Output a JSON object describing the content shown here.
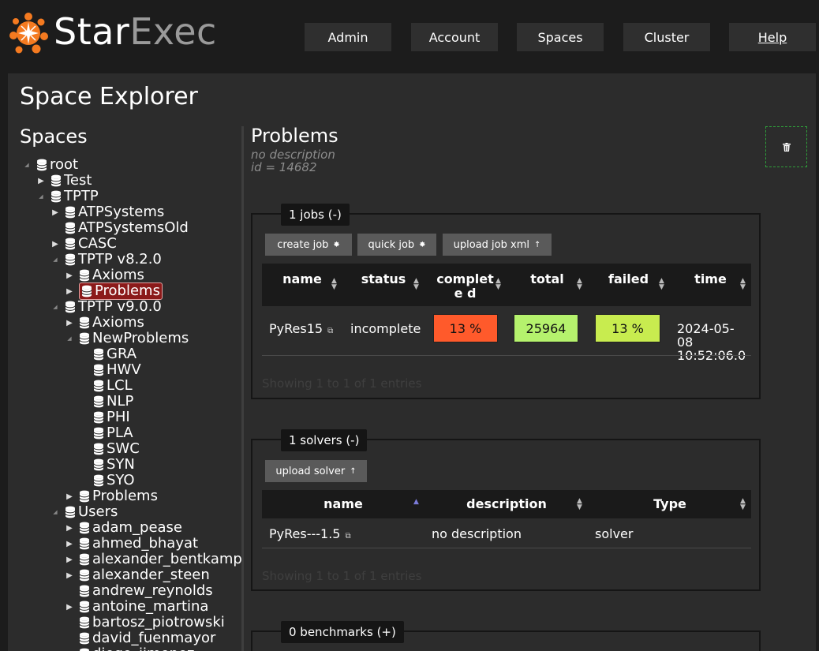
{
  "brand": {
    "star": "Star",
    "exec": "Exec"
  },
  "nav": [
    {
      "label": "Admin"
    },
    {
      "label": "Account"
    },
    {
      "label": "Spaces"
    },
    {
      "label": "Cluster"
    },
    {
      "label": "Help"
    }
  ],
  "page_title": "Space Explorer",
  "spaces_title": "Spaces",
  "tree": [
    {
      "label": "root",
      "depth": 0,
      "arrow": "open"
    },
    {
      "label": "Test",
      "depth": 1,
      "arrow": "closed"
    },
    {
      "label": "TPTP",
      "depth": 1,
      "arrow": "open"
    },
    {
      "label": "ATPSystems",
      "depth": 2,
      "arrow": "closed"
    },
    {
      "label": "ATPSystemsOld",
      "depth": 2,
      "arrow": "none"
    },
    {
      "label": "CASC",
      "depth": 2,
      "arrow": "closed"
    },
    {
      "label": "TPTP v8.2.0",
      "depth": 2,
      "arrow": "open"
    },
    {
      "label": "Axioms",
      "depth": 3,
      "arrow": "closed"
    },
    {
      "label": "Problems",
      "depth": 3,
      "arrow": "closed",
      "selected": true
    },
    {
      "label": "TPTP v9.0.0",
      "depth": 2,
      "arrow": "open"
    },
    {
      "label": "Axioms",
      "depth": 3,
      "arrow": "closed"
    },
    {
      "label": "NewProblems",
      "depth": 3,
      "arrow": "open"
    },
    {
      "label": "GRA",
      "depth": 4,
      "arrow": "none"
    },
    {
      "label": "HWV",
      "depth": 4,
      "arrow": "none"
    },
    {
      "label": "LCL",
      "depth": 4,
      "arrow": "none"
    },
    {
      "label": "NLP",
      "depth": 4,
      "arrow": "none"
    },
    {
      "label": "PHI",
      "depth": 4,
      "arrow": "none"
    },
    {
      "label": "PLA",
      "depth": 4,
      "arrow": "none"
    },
    {
      "label": "SWC",
      "depth": 4,
      "arrow": "none"
    },
    {
      "label": "SYN",
      "depth": 4,
      "arrow": "none"
    },
    {
      "label": "SYO",
      "depth": 4,
      "arrow": "none"
    },
    {
      "label": "Problems",
      "depth": 3,
      "arrow": "closed"
    },
    {
      "label": "Users",
      "depth": 2,
      "arrow": "open"
    },
    {
      "label": "adam_pease",
      "depth": 3,
      "arrow": "closed"
    },
    {
      "label": "ahmed_bhayat",
      "depth": 3,
      "arrow": "closed"
    },
    {
      "label": "alexander_bentkamp",
      "depth": 3,
      "arrow": "closed"
    },
    {
      "label": "alexander_steen",
      "depth": 3,
      "arrow": "closed"
    },
    {
      "label": "andrew_reynolds",
      "depth": 3,
      "arrow": "none"
    },
    {
      "label": "antoine_martina",
      "depth": 3,
      "arrow": "closed"
    },
    {
      "label": "bartosz_piotrowski",
      "depth": 3,
      "arrow": "none"
    },
    {
      "label": "david_fuenmayor",
      "depth": 3,
      "arrow": "none"
    },
    {
      "label": "diego_jimenez",
      "depth": 3,
      "arrow": "none"
    }
  ],
  "space": {
    "name": "Problems",
    "description": "no description",
    "id_text": "id = 14682"
  },
  "jobs": {
    "legend": "1 jobs (-)",
    "buttons": [
      "create job",
      "quick job",
      "upload job xml"
    ],
    "columns": [
      "name",
      "status",
      "complete d",
      "total",
      "failed",
      "time"
    ],
    "row": {
      "name": "PyRes15",
      "status": "incomplete",
      "complete": "13 %",
      "total": "25964",
      "failed": "13 %",
      "time": "2024-05-08 10:52:06.0"
    },
    "footer": "Showing 1 to 1 of 1 entries"
  },
  "solvers": {
    "legend": "1 solvers (-)",
    "button": "upload solver",
    "columns": [
      "name",
      "description",
      "Type"
    ],
    "row": {
      "name": "PyRes---1.5",
      "description": "no description",
      "type": "solver"
    },
    "footer": "Showing 1 to 1 of 1 entries"
  },
  "benchmarks": {
    "legend": "0 benchmarks (+)"
  },
  "colors": {
    "complete_badge": "#ff5a2b",
    "total_badge": "#b5f26d",
    "failed_badge": "#c8ec4f",
    "selected_node": "#8b1a1a",
    "logo_orange": "#f47a20"
  }
}
